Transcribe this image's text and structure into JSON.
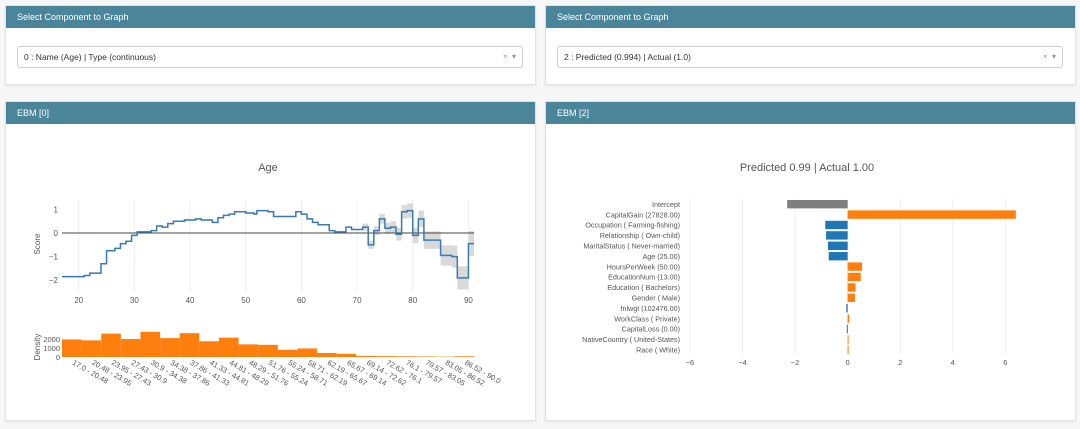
{
  "left": {
    "selector": {
      "title": "Select Component to Graph",
      "value": "0 : Name (Age) | Type (continuous)",
      "clear_icon": "×",
      "arrow_icon": "▾"
    },
    "panel_title": "EBM [0]"
  },
  "right": {
    "selector": {
      "title": "Select Component to Graph",
      "value": "2 : Predicted (0.994) | Actual (1.0)",
      "clear_icon": "×",
      "arrow_icon": "▾"
    },
    "panel_title": "EBM [2]"
  },
  "chart_data": [
    {
      "type": "line",
      "title": "Age",
      "ylabel": "Score",
      "xlim": [
        17,
        91
      ],
      "ylim": [
        -2.5,
        1.4
      ],
      "xticks": [
        20,
        30,
        40,
        50,
        60,
        70,
        80,
        90
      ],
      "yticks": [
        1,
        0,
        -1,
        -2
      ],
      "line_color": "#3a7cb0",
      "band_color": "#d9d9d9",
      "steps": [
        [
          17,
          -1.85
        ],
        [
          21,
          -1.8
        ],
        [
          22,
          -1.7
        ],
        [
          24,
          -1.3
        ],
        [
          25,
          -0.75
        ],
        [
          26.5,
          -0.65
        ],
        [
          27.5,
          -0.45
        ],
        [
          28.5,
          -0.35
        ],
        [
          29.5,
          -0.1
        ],
        [
          30.5,
          0.05
        ],
        [
          33,
          0.1
        ],
        [
          34,
          0.3
        ],
        [
          35,
          0.25
        ],
        [
          36,
          0.4
        ],
        [
          37,
          0.5
        ],
        [
          39,
          0.55
        ],
        [
          41,
          0.6
        ],
        [
          42,
          0.55
        ],
        [
          44,
          0.45
        ],
        [
          45,
          0.65
        ],
        [
          46,
          0.75
        ],
        [
          47,
          0.8
        ],
        [
          48,
          0.9
        ],
        [
          50,
          0.85
        ],
        [
          51.5,
          0.8
        ],
        [
          52,
          0.95
        ],
        [
          54,
          0.9
        ],
        [
          55,
          0.7
        ],
        [
          59,
          0.9
        ],
        [
          60,
          0.8
        ],
        [
          61,
          0.6
        ],
        [
          62,
          0.45
        ],
        [
          63,
          0.35
        ],
        [
          65,
          0.1
        ],
        [
          66,
          0.05
        ],
        [
          68,
          0.25
        ],
        [
          69,
          0.15
        ],
        [
          71,
          0.25
        ],
        [
          72,
          -0.5
        ],
        [
          73,
          0.1
        ],
        [
          74,
          0.6
        ],
        [
          75,
          0.2
        ],
        [
          76,
          0.25
        ],
        [
          77,
          -0.05
        ],
        [
          78,
          0.9
        ],
        [
          79,
          0.95
        ],
        [
          80,
          -0.1
        ],
        [
          81,
          0.6
        ],
        [
          82,
          -0.3
        ],
        [
          85,
          -0.95
        ],
        [
          87,
          -1.0
        ],
        [
          88,
          -1.9
        ],
        [
          90,
          -0.45
        ],
        [
          91,
          -0.45
        ]
      ]
    },
    {
      "type": "bar",
      "ylabel": "Density",
      "yticks": [
        2000,
        1000,
        0
      ],
      "ylim": [
        0,
        3000
      ],
      "color": "#ff7f0e",
      "categories": [
        "17.0 - 20.48",
        "20.48 - 23.95",
        "23.95 - 27.43",
        "27.43 - 30.9",
        "30.9 - 34.38",
        "34.38 - 37.86",
        "37.86 - 41.33",
        "41.33 - 44.81",
        "44.81 - 48.29",
        "48.29 - 51.76",
        "51.76 - 55.24",
        "55.24 - 58.71",
        "58.71 - 62.19",
        "62.19 - 65.67",
        "65.67 - 69.14",
        "69.14 - 72.62",
        "72.62 - 76.1",
        "76.1 - 79.57",
        "79.57 - 83.05",
        "83.05 - 86.52",
        "86.52 - 90.0"
      ],
      "values": [
        1950,
        1850,
        2600,
        2000,
        2800,
        2100,
        2650,
        1750,
        2150,
        1400,
        1350,
        800,
        950,
        450,
        350,
        120,
        100,
        80,
        60,
        40,
        80
      ]
    },
    {
      "type": "bar",
      "orientation": "horizontal",
      "title": "Predicted 0.99 | Actual 1.00",
      "xlim": [
        -7.9,
        7.7
      ],
      "xticks": [
        -6,
        -4,
        -2,
        0,
        2,
        4,
        6
      ],
      "colors": {
        "intercept": "#7f7f7f",
        "positive": "#ff7f0e",
        "negative": "#1f77b4"
      },
      "categories": [
        "Intercept",
        "CapitalGain (27828.00)",
        "Occupation ( Farming-fishing)",
        "Relationship ( Own-child)",
        "MaritalStatus ( Never-married)",
        "Age (25.00)",
        "HoursPerWeek (50.00)",
        "EducationNum (13.00)",
        "Education ( Bachelors)",
        "Gender ( Male)",
        "fnlwgt (102476.00)",
        "WorkClass ( Private)",
        "CapitalLoss (0.00)",
        "NativeCountry ( United-States)",
        "Race ( White)"
      ],
      "values": [
        -2.3,
        6.4,
        -0.85,
        -0.82,
        -0.75,
        -0.72,
        0.55,
        0.5,
        0.3,
        0.28,
        -0.05,
        0.06,
        -0.03,
        0.03,
        0.03
      ]
    }
  ]
}
